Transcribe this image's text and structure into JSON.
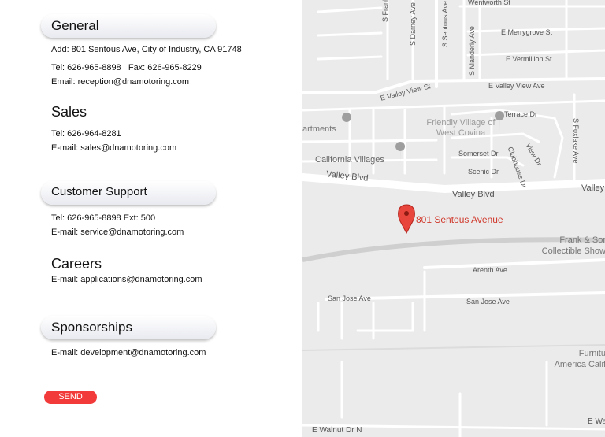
{
  "general": {
    "title": "General",
    "address": "Add: 801 Sentous Ave, City of Industry, CA 91748",
    "tel_fax": "Tel: 626-965-8898   Fax: 626-965-8229",
    "email": "Email: reception@dnamotoring.com"
  },
  "sales": {
    "title": "Sales",
    "tel": "Tel: 626-964-8281",
    "email": "E-mail: sales@dnamotoring.com"
  },
  "support": {
    "title": "Customer Support",
    "tel": "Tel: 626-965-8898 Ext: 500",
    "email": "E-mail: service@dnamotoring.com"
  },
  "careers": {
    "title": "Careers",
    "email": "E-mail: applications@dnamotoring.com"
  },
  "sponsorships": {
    "title": "Sponsorships",
    "email": "E-mail: development@dnamotoring.com"
  },
  "send_label": "SEND",
  "colors": {
    "accent": "#f23a3a",
    "marker": "#d0392c",
    "map_bg": "#ebebeb"
  },
  "map": {
    "marker_label": "801 Sentous Avenue",
    "streets": [
      "S Frank",
      "S Darney Ave",
      "S Sentous Ave",
      "Wentworth St",
      "E Merrygrove St",
      "E Vermillion St",
      "S Manderly Ave",
      "E Valley View Ave",
      "E Valley View St",
      "Terrace Dr",
      "S Foxlake Ave",
      "Somerset Dr",
      "Scenic Dr",
      "Clubhouse Dr",
      "View Dr",
      "Valley Blvd",
      "Valley Blvd",
      "Valley",
      "Arenth Ave",
      "San Jose Ave",
      "San Jose Ave",
      "E Walnut Dr N",
      "E Wa"
    ],
    "places": [
      "artments",
      "Friendly Village of West Covina",
      "California Villages",
      "Frank & Sor Collectible Show",
      "Furnitu America Calif"
    ]
  }
}
